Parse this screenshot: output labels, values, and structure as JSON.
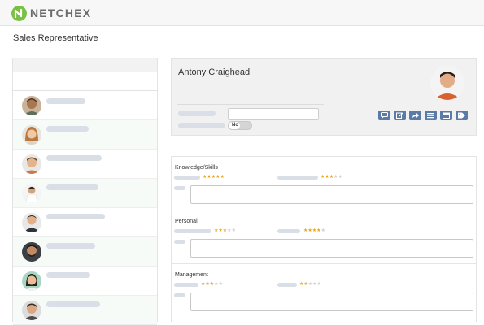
{
  "app": {
    "logo_text": "NETCHEX"
  },
  "page": {
    "title": "Sales Representative"
  },
  "employees": [
    {
      "avatar": "person-avatar-1"
    },
    {
      "avatar": "person-avatar-2"
    },
    {
      "avatar": "person-avatar-3"
    },
    {
      "avatar": "person-avatar-4"
    },
    {
      "avatar": "person-avatar-5"
    },
    {
      "avatar": "person-avatar-6"
    },
    {
      "avatar": "person-avatar-7"
    },
    {
      "avatar": "person-avatar-8"
    }
  ],
  "profile": {
    "name": "Antony Craighead",
    "toggle_label": "No",
    "actions": [
      "comment-icon",
      "edit-icon",
      "share-icon",
      "list-icon",
      "calendar-icon",
      "tag-icon"
    ]
  },
  "sections": [
    {
      "title": "Knowledge/Skills",
      "ratings": [
        5,
        3
      ],
      "max_rating": 5
    },
    {
      "title": "Personal",
      "ratings": [
        3,
        4
      ],
      "max_rating": 5
    },
    {
      "title": "Management",
      "ratings": [
        3,
        2
      ],
      "max_rating": 5
    }
  ],
  "colors": {
    "brand_green": "#79c142",
    "action_blue": "#5b7aa6",
    "star_gold": "#e8a317"
  }
}
